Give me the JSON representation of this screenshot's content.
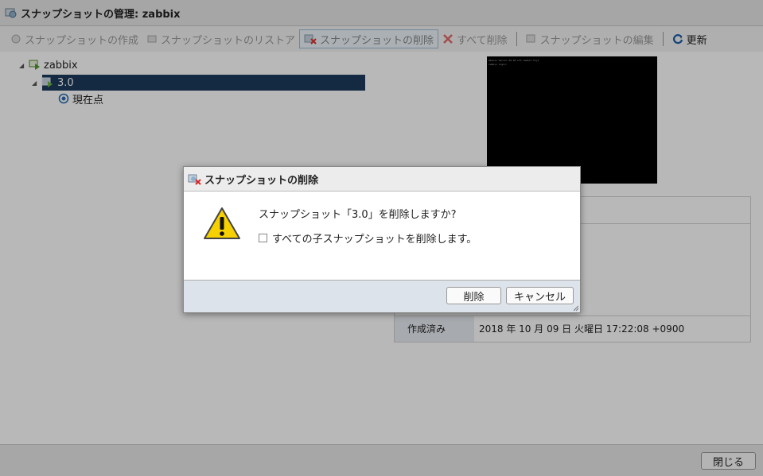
{
  "window": {
    "title": "スナップショットの管理: zabbix"
  },
  "toolbar": {
    "take": "スナップショットの作成",
    "revert": "スナップショットのリストア",
    "delete": "スナップショットの削除",
    "delete_all": "すべて削除",
    "edit": "スナップショットの編集",
    "refresh": "更新"
  },
  "tree": {
    "vm": "zabbix",
    "snapshot": "3.0",
    "current": "現在点"
  },
  "details": {
    "created_label": "作成済み",
    "created_value": "2018 年 10 月 09 日 火曜日 17:22:08 +0900"
  },
  "footer": {
    "close": "閉じる"
  },
  "dialog": {
    "title": "スナップショットの削除",
    "message": "スナップショット「3.0」を削除しますか?",
    "checkbox_label": "すべての子スナップショットを削除します。",
    "checkbox_checked": false,
    "delete_button": "削除",
    "cancel_button": "キャンセル"
  },
  "console": {
    "line1": "Ubuntu Server 20.04 LTS zabbix tty1",
    "line2": "zabbix login:"
  }
}
